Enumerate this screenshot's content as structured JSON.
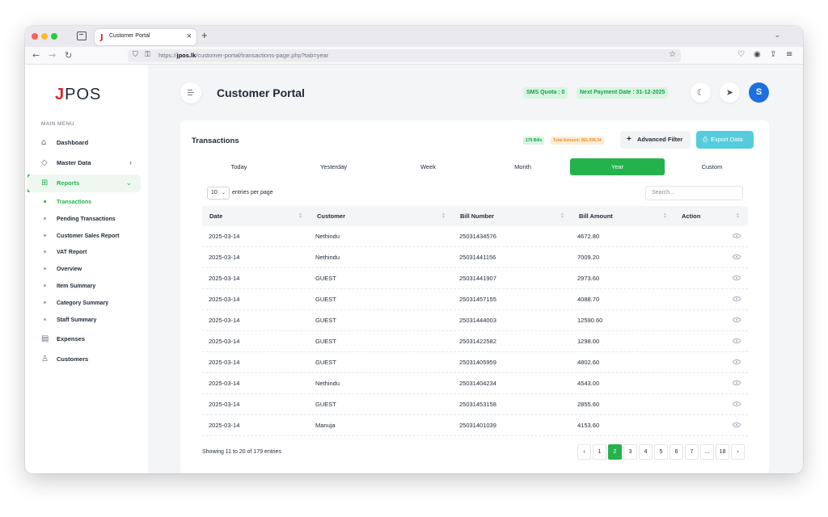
{
  "browser": {
    "tab_title": "Customer Portal",
    "tab_favicon": "J",
    "url_prefix": "https://",
    "url_domain": "jpos.lk",
    "url_path": "/customer-portal/transactions-page.php?tab=year"
  },
  "sidebar": {
    "logo_j": "J",
    "logo_rest": "POS",
    "menu_head": "MAIN MENU",
    "items": [
      {
        "label": "Dashboard",
        "icon": "home-icon"
      },
      {
        "label": "Master Data",
        "icon": "tag-icon"
      },
      {
        "label": "Reports",
        "icon": "grid-icon"
      }
    ],
    "sub_items": [
      {
        "label": "Transactions"
      },
      {
        "label": "Pending Transactions"
      },
      {
        "label": "Customer Sales Report"
      },
      {
        "label": "VAT Report"
      },
      {
        "label": "Overview"
      },
      {
        "label": "Item Summary"
      },
      {
        "label": "Category Summary"
      },
      {
        "label": "Staff Summary"
      }
    ],
    "bottom_items": [
      {
        "label": "Expenses",
        "icon": "receipt-icon"
      },
      {
        "label": "Customers",
        "icon": "user-icon"
      }
    ]
  },
  "header": {
    "title": "Customer Portal",
    "sms_quota": "SMS Quota : 0",
    "next_payment": "Next Payment Date : 31-12-2025",
    "avatar_letter": "S"
  },
  "card": {
    "title": "Transactions",
    "bills_chip": "179 Bills",
    "total_chip": "Total Amount: 961,056.34",
    "advanced_filter": "Advanced Filter",
    "export_data": "Export Data",
    "period_tabs": [
      "Today",
      "Yesterday",
      "Week",
      "Month",
      "Year",
      "Custom"
    ],
    "active_tab": "Year",
    "entries_value": "10",
    "entries_label": "entries per page",
    "search_placeholder": "Search...",
    "columns": [
      "Date",
      "Customer",
      "Bill Number",
      "Bill Amount",
      "Action"
    ],
    "rows": [
      [
        "2025-03-14",
        "Nethindu",
        "25031434576",
        "4672.80"
      ],
      [
        "2025-03-14",
        "Nethindu",
        "25031441156",
        "7009.20"
      ],
      [
        "2025-03-14",
        "GUEST",
        "25031441907",
        "2973.60"
      ],
      [
        "2025-03-14",
        "GUEST",
        "25031457155",
        "4088.70"
      ],
      [
        "2025-03-14",
        "GUEST",
        "25031444003",
        "12590.60"
      ],
      [
        "2025-03-14",
        "GUEST",
        "25031422582",
        "1298.00"
      ],
      [
        "2025-03-14",
        "GUEST",
        "25031405959",
        "4802.60"
      ],
      [
        "2025-03-14",
        "Nethindu",
        "25031404234",
        "4543.00"
      ],
      [
        "2025-03-14",
        "GUEST",
        "25031453158",
        "2855.60"
      ],
      [
        "2025-03-14",
        "Manuja",
        "25031401039",
        "4153.60"
      ]
    ],
    "info": "Showing 11 to 20 of 179 entries",
    "pages": [
      "‹",
      "1",
      "2",
      "3",
      "4",
      "5",
      "6",
      "7",
      "…",
      "18",
      "›"
    ],
    "current_page": "2"
  },
  "colors": {
    "accent_green": "#24b24d",
    "brand_red": "#e1262b",
    "export_cyan": "#55ccdc",
    "avatar_blue": "#1d6fe0"
  }
}
